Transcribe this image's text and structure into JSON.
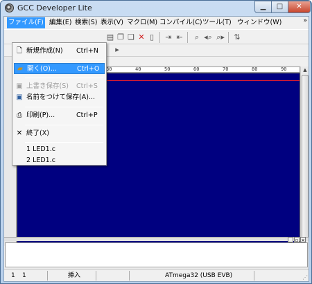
{
  "window": {
    "title": "GCC Developer Lite"
  },
  "menubar": {
    "items": [
      {
        "label": "ファイル(F)"
      },
      {
        "label": "編集(E)"
      },
      {
        "label": "検索(S)"
      },
      {
        "label": "表示(V)"
      },
      {
        "label": "マクロ(M)"
      },
      {
        "label": "コンパイル(C)"
      },
      {
        "label": "ツール(T)"
      },
      {
        "label": "ウィンドウ(W)"
      }
    ],
    "more": "»"
  },
  "file_menu": {
    "items": [
      {
        "label": "新規作成(N)",
        "shortcut": "Ctrl+N",
        "icon": "new-file-icon",
        "enabled": true
      },
      {
        "label": "開く(O)...",
        "shortcut": "Ctrl+O",
        "icon": "open-folder-icon",
        "enabled": true,
        "highlighted": true
      },
      {
        "label": "上書き保存(S)",
        "shortcut": "Ctrl+S",
        "icon": "save-icon",
        "enabled": false
      },
      {
        "label": "名前をつけて保存(A)...",
        "shortcut": "",
        "icon": "save-as-icon",
        "enabled": true
      },
      {
        "label": "印刷(P)...",
        "shortcut": "Ctrl+P",
        "icon": "print-icon",
        "enabled": true
      },
      {
        "label": "終了(X)",
        "shortcut": "",
        "icon": "exit-icon",
        "enabled": true
      },
      {
        "label": "1 LED1.c",
        "shortcut": "",
        "enabled": true
      },
      {
        "label": "2 LED1.c",
        "shortcut": "",
        "enabled": true
      }
    ]
  },
  "ruler": {
    "marks": [
      "30",
      "40",
      "50",
      "60",
      "70",
      "80",
      "90"
    ]
  },
  "statusbar": {
    "line": "1",
    "column": "1",
    "mode": "挿入",
    "target": "ATmega32 (USB EVB)"
  },
  "colors": {
    "editor_background": "#000080",
    "cursor_line": "#ff2020",
    "menu_highlight": "#3399ff"
  }
}
